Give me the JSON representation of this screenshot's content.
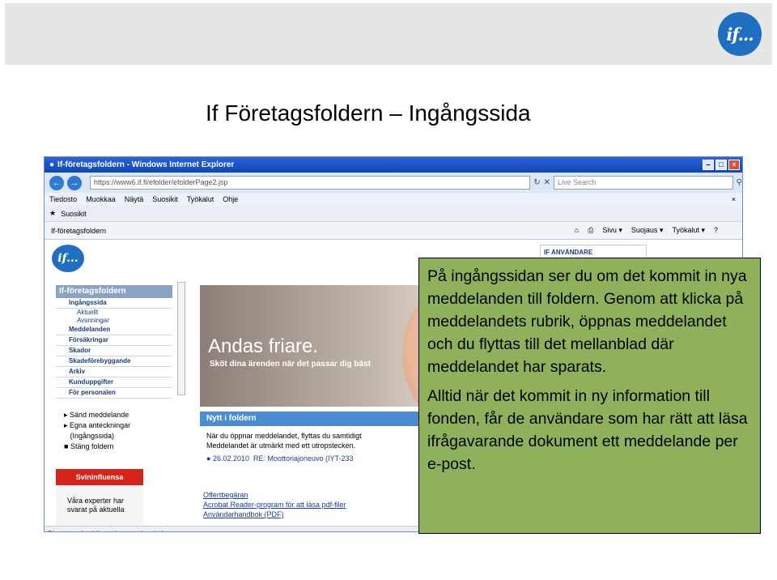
{
  "slide": {
    "title": "If Företagsfoldern – Ingångssida",
    "logo_text": "if..."
  },
  "browser": {
    "window_title": "If-företagsfoldern - Windows Internet Explorer",
    "url": "https://www6.if.fi/efolder/efolderPage2.jsp",
    "search_placeholder": "Live Search",
    "menu": [
      "Tiedosto",
      "Muokkaa",
      "Näytä",
      "Suosikit",
      "Työkalut",
      "Ohje"
    ],
    "favorites_label": "Suosikit",
    "tab_label": "If-företagsfoldern",
    "toolbar": [
      "Sivu ▾",
      "Suojaus ▾",
      "Työkalut ▾"
    ],
    "status_text": "Please wait while scripts are loaded..."
  },
  "page": {
    "logo_text": "if...",
    "user_box": "IF ANVÄNDARE",
    "nav_header": "If-företagsfoldern",
    "nav_items": [
      {
        "label": "Ingångssida",
        "sub": false
      },
      {
        "label": "Aktuellt",
        "sub": true
      },
      {
        "label": "Avsnningar",
        "sub": true
      },
      {
        "label": "Meddelanden",
        "sub": false
      },
      {
        "label": "Försäkringar",
        "sub": false
      },
      {
        "label": "Skador",
        "sub": false
      },
      {
        "label": "Skadeförebyggande",
        "sub": false
      },
      {
        "label": "Arkiv",
        "sub": false
      },
      {
        "label": "Kunduppgifter",
        "sub": false
      },
      {
        "label": "För personalen",
        "sub": false
      }
    ],
    "actions": [
      "Sänd meddelande",
      "Egna anteckningar",
      "(Ingångssida)",
      "Stäng foldern"
    ],
    "flu_box": {
      "title": "Svininfluensa",
      "line1": "Våra experter har",
      "line2": "svarat på aktuella"
    },
    "hero": {
      "headline": "Andas friare.",
      "subline": "Sköt dina ärenden när det passar dig bäst"
    },
    "news": {
      "header": "Nytt i foldern",
      "text1": "När du öppnar meddelandet, flyttas du samtidigt",
      "text2": "Meddelandet är utmärkt med ett utropstecken.",
      "item_date": "26.02.2010",
      "item_title": "RE: Moottoriajoneuvo (IYT-233",
      "links": [
        "Offertbegäran",
        "Acrobat Reader-program för att läsa pdf-filer",
        "Användarhandbok (PDF)"
      ]
    }
  },
  "callout": {
    "paragraph1": "På ingångssidan ser du om det kommit in nya meddelanden till foldern. Genom att klicka på meddelandets rubrik, öppnas meddelandet och du flyttas till det mellanblad där meddelandet har sparats.",
    "paragraph2": "Alltid när det kommit in ny information till fonden, får de användare som har rätt att läsa ifrågavarande dokument ett meddelande per e-post."
  }
}
